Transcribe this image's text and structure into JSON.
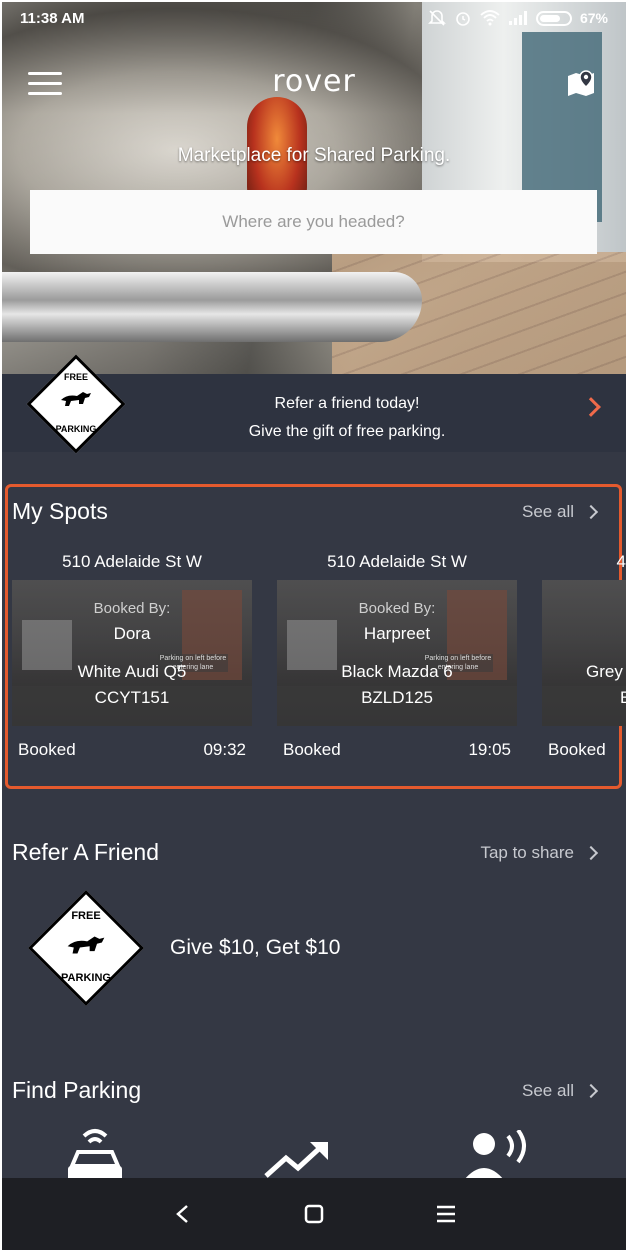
{
  "status_bar": {
    "time": "11:38 AM",
    "battery": "67%"
  },
  "header": {
    "logo": "rover",
    "tagline": "Marketplace for Shared Parking.",
    "search_placeholder": "Where are you headed?"
  },
  "refer_banner": {
    "badge_top": "FREE",
    "badge_bottom": "PARKING",
    "line1": "Refer a friend today!",
    "line2": "Give the gift of free parking."
  },
  "my_spots": {
    "title": "My Spots",
    "see_all": "See all",
    "cards": [
      {
        "address": "510 Adelaide St W",
        "booked_by_label": "Booked By:",
        "name": "Dora",
        "car": "White Audi Q5",
        "plate": "CCYT151",
        "status": "Booked",
        "time": "09:32",
        "sign": "Parking on left before entering lane"
      },
      {
        "address": "510 Adelaide St W",
        "booked_by_label": "Booked By:",
        "name": "Harpreet",
        "car": "Black Mazda 6",
        "plate": "BZLD125",
        "status": "Booked",
        "time": "19:05",
        "sign": "Parking on left before entering lane"
      },
      {
        "address": "4",
        "car": "Grey",
        "plate": "E",
        "status": "Booked"
      }
    ]
  },
  "refer_friend": {
    "title": "Refer A Friend",
    "action": "Tap to share",
    "badge_top": "FREE",
    "badge_bottom": "PARKING",
    "offer": "Give $10, Get $10"
  },
  "find_parking": {
    "title": "Find Parking",
    "see_all": "See all",
    "icons": [
      "car-wifi-icon",
      "trending-up-icon",
      "person-broadcast-icon"
    ]
  },
  "navbar": {
    "icons": [
      "back-icon",
      "home-icon",
      "recents-icon"
    ]
  },
  "colors": {
    "background": "#343844",
    "accent": "#e45a2e",
    "chevron": "#f06a4a"
  }
}
